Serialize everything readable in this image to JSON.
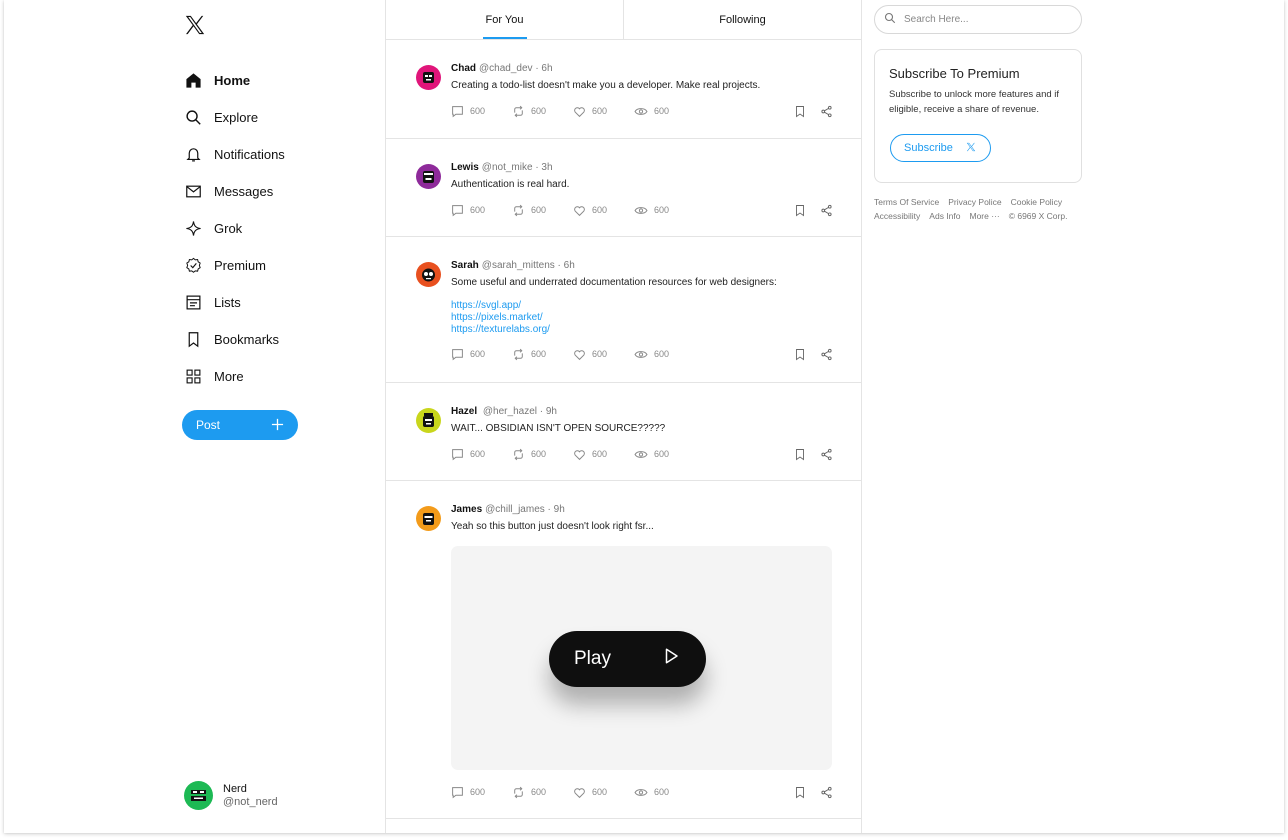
{
  "colors": {
    "accent": "#1d9bf0",
    "border": "#e4e4e4",
    "text": "#111111"
  },
  "sidebar": {
    "logo": "x-logo",
    "items": [
      {
        "label": "Home",
        "icon": "home-icon",
        "active": true
      },
      {
        "label": "Explore",
        "icon": "search-icon"
      },
      {
        "label": "Notifications",
        "icon": "bell-icon"
      },
      {
        "label": "Messages",
        "icon": "mail-icon"
      },
      {
        "label": "Grok",
        "icon": "sparkle-icon"
      },
      {
        "label": "Premium",
        "icon": "verified-icon"
      },
      {
        "label": "Lists",
        "icon": "list-icon"
      },
      {
        "label": "Bookmarks",
        "icon": "bookmark-icon"
      },
      {
        "label": "More",
        "icon": "grid-icon"
      }
    ],
    "post_label": "Post",
    "user": {
      "name": "Nerd",
      "handle": "@not_nerd"
    }
  },
  "tabs": [
    {
      "label": "For You",
      "active": true
    },
    {
      "label": "Following"
    }
  ],
  "posts": [
    {
      "name": "Chad",
      "handle": "@chad_dev",
      "time": "· 6h",
      "text": "Creating a todo-list doesn't make you a developer. Make real projects.",
      "avatar_color": "#e0157a",
      "replies": "600",
      "reposts": "600",
      "likes": "600",
      "views": "600"
    },
    {
      "name": "Lewis",
      "handle": "@not_mike",
      "time": "· 3h",
      "text": "Authentication is real hard.",
      "avatar_color": "#8e2a9a",
      "replies": "600",
      "reposts": "600",
      "likes": "600",
      "views": "600"
    },
    {
      "name": "Sarah",
      "handle": "@sarah_mittens",
      "time": "· 6h",
      "text": "Some useful and underrated documentation resources for web designers:",
      "links": [
        "https://svgl.app/",
        "https://pixels.market/",
        "https://texturelabs.org/"
      ],
      "avatar_color": "#e8501f",
      "replies": "600",
      "reposts": "600",
      "likes": "600",
      "views": "600"
    },
    {
      "name": "Hazel",
      "handle": "@her_hazel",
      "time": "· 9h",
      "text": "WAIT... OBSIDIAN ISN'T OPEN SOURCE?????",
      "avatar_color": "#c9d61c",
      "replies": "600",
      "reposts": "600",
      "likes": "600",
      "views": "600"
    },
    {
      "name": "James",
      "handle": "@chill_james",
      "time": "· 9h",
      "text": "Yeah so this button just doesn't look right fsr...",
      "media": {
        "button_label": "Play"
      },
      "avatar_color": "#f39b1a",
      "replies": "600",
      "reposts": "600",
      "likes": "600",
      "views": "600"
    }
  ],
  "search": {
    "placeholder": "Search Here..."
  },
  "premium": {
    "title": "Subscribe To Premium",
    "description": "Subscribe to unlock more features and if eligible, receive a share of revenue.",
    "button_label": "Subscribe"
  },
  "footer": {
    "links": [
      "Terms Of Service",
      "Privacy Police",
      "Cookie Policy",
      "Accessibility",
      "Ads Info",
      "More ···"
    ],
    "copyright": "© 6969 X Corp."
  }
}
